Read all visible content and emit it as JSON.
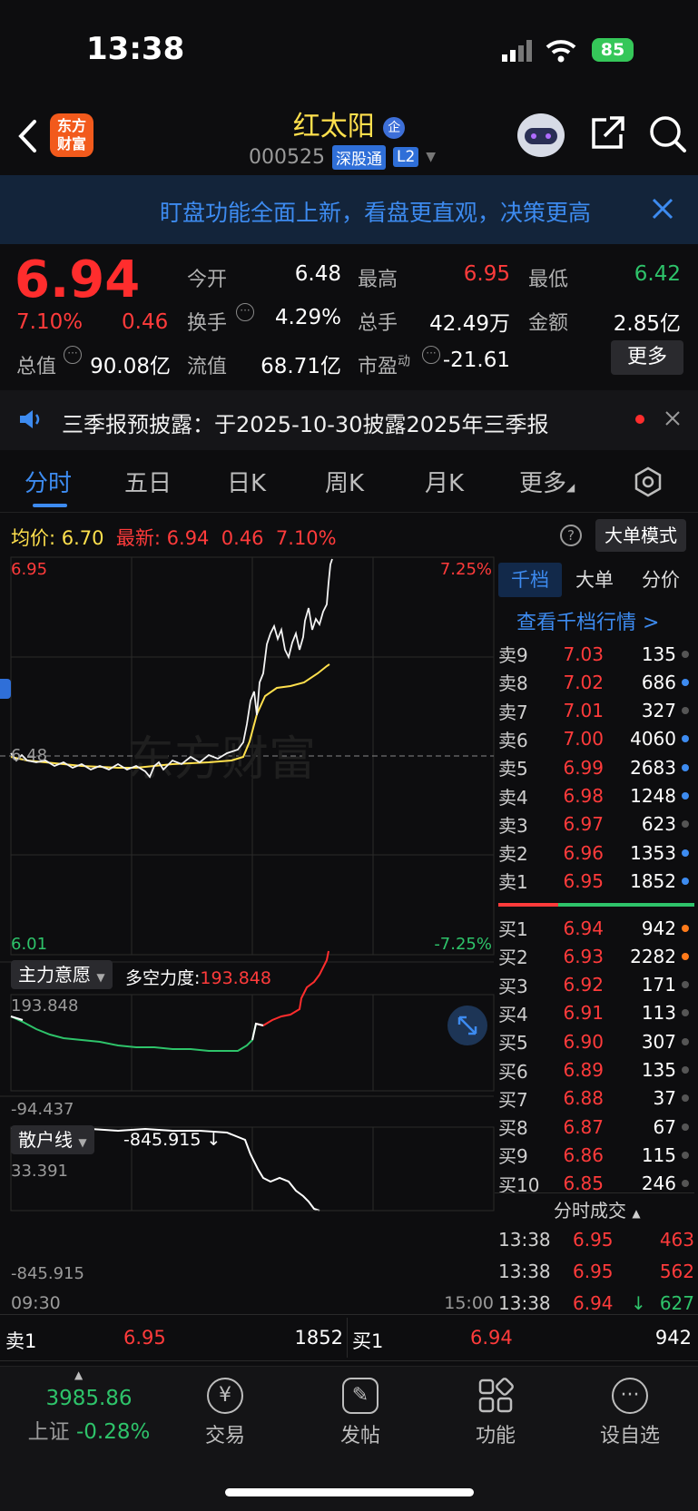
{
  "status_bar": {
    "time": "13:38",
    "battery": "85"
  },
  "header": {
    "app_logo_line1": "东方",
    "app_logo_line2": "财富",
    "stock_name": "红太阳",
    "corp_badge": "企",
    "stock_code": "000525",
    "tag_connect": "深股通",
    "tag_level": "L2"
  },
  "banner": {
    "text": "盯盘功能全面上新，看盘更直观，决策更高"
  },
  "quote": {
    "price": "6.94",
    "change_pct": "7.10%",
    "change": "0.46",
    "open_label": "今开",
    "open": "6.48",
    "high_label": "最高",
    "high": "6.95",
    "low_label": "最低",
    "low": "6.42",
    "turnover_label": "换手",
    "turnover": "4.29%",
    "volume_label": "总手",
    "volume": "42.49万",
    "amount_label": "金额",
    "amount": "2.85亿",
    "mktcap_label": "总值",
    "mktcap": "90.08亿",
    "float_label": "流值",
    "float_cap": "68.71亿",
    "pe_label": "市盈",
    "pe_sup": "动",
    "pe": "-21.61",
    "more": "更多"
  },
  "notice": {
    "text": "三季报预披露：于2025-10-30披露2025年三季报"
  },
  "tabs": [
    "分时",
    "五日",
    "日K",
    "周K",
    "月K",
    "更多"
  ],
  "chart_header": {
    "avg_label": "均价:",
    "avg": "6.70",
    "latest_label": "最新:",
    "latest": "6.94",
    "chg": "0.46",
    "pct": "7.10%",
    "big_order_mode": "大单模式"
  },
  "chart_labels": {
    "top_price": "6.95",
    "top_pct": "7.25%",
    "mid_price": "6.48",
    "bottom_price": "6.01",
    "bottom_pct": "-7.25%",
    "watermark": "东方财富"
  },
  "indicator1": {
    "name": "主力意愿",
    "strength_label": "多空力度:",
    "strength": "193.848",
    "max": "193.848",
    "min": "-94.437"
  },
  "indicator2": {
    "name": "散户线",
    "value": "-845.915 ↓",
    "max": "33.391",
    "min": "-845.915"
  },
  "time_axis": {
    "start": "09:30",
    "end": "15:00"
  },
  "book_tabs": [
    "千档",
    "大单",
    "分价"
  ],
  "book_link": "查看千档行情 >",
  "asks": [
    {
      "label": "卖9",
      "price": "7.03",
      "vol": "135",
      "dot": "#555555"
    },
    {
      "label": "卖8",
      "price": "7.02",
      "vol": "686",
      "dot": "#3d8bf0"
    },
    {
      "label": "卖7",
      "price": "7.01",
      "vol": "327",
      "dot": "#555555"
    },
    {
      "label": "卖6",
      "price": "7.00",
      "vol": "4060",
      "dot": "#3d8bf0"
    },
    {
      "label": "卖5",
      "price": "6.99",
      "vol": "2683",
      "dot": "#3d8bf0"
    },
    {
      "label": "卖4",
      "price": "6.98",
      "vol": "1248",
      "dot": "#3d8bf0"
    },
    {
      "label": "卖3",
      "price": "6.97",
      "vol": "623",
      "dot": "#555555"
    },
    {
      "label": "卖2",
      "price": "6.96",
      "vol": "1353",
      "dot": "#3d8bf0"
    },
    {
      "label": "卖1",
      "price": "6.95",
      "vol": "1852",
      "dot": "#3d8bf0"
    }
  ],
  "bids": [
    {
      "label": "买1",
      "price": "6.94",
      "vol": "942",
      "dot": "#ff7a1a"
    },
    {
      "label": "买2",
      "price": "6.93",
      "vol": "2282",
      "dot": "#ff7a1a"
    },
    {
      "label": "买3",
      "price": "6.92",
      "vol": "171",
      "dot": "#555555"
    },
    {
      "label": "买4",
      "price": "6.91",
      "vol": "113",
      "dot": "#555555"
    },
    {
      "label": "买5",
      "price": "6.90",
      "vol": "307",
      "dot": "#555555"
    },
    {
      "label": "买6",
      "price": "6.89",
      "vol": "135",
      "dot": "#555555"
    },
    {
      "label": "买7",
      "price": "6.88",
      "vol": "37",
      "dot": "#555555"
    },
    {
      "label": "买8",
      "price": "6.87",
      "vol": "67",
      "dot": "#555555"
    },
    {
      "label": "买9",
      "price": "6.86",
      "vol": "115",
      "dot": "#555555"
    },
    {
      "label": "买10",
      "price": "6.85",
      "vol": "246",
      "dot": "#555555"
    }
  ],
  "trades_title": "分时成交",
  "trades": [
    {
      "time": "13:38",
      "price": "6.95",
      "vol": "463",
      "arrow": ""
    },
    {
      "time": "13:38",
      "price": "6.95",
      "vol": "562",
      "arrow": ""
    },
    {
      "time": "13:38",
      "price": "6.94",
      "vol": "627",
      "arrow": "↓"
    }
  ],
  "bottom_quote": {
    "ask_label": "卖1",
    "ask_price": "6.95",
    "ask_vol": "1852",
    "bid_label": "买1",
    "bid_price": "6.94",
    "bid_vol": "942"
  },
  "bottom_nav": {
    "index_value": "3985.86",
    "index_name": "上证",
    "index_chg": "-0.28%",
    "trade": "交易",
    "post": "发帖",
    "function": "功能",
    "watchlist": "设自选"
  },
  "colors": {
    "up": "#ff3b3b",
    "down": "#2ec36a",
    "accent": "#3d8bf0",
    "avg_line": "#ffe04d"
  }
}
